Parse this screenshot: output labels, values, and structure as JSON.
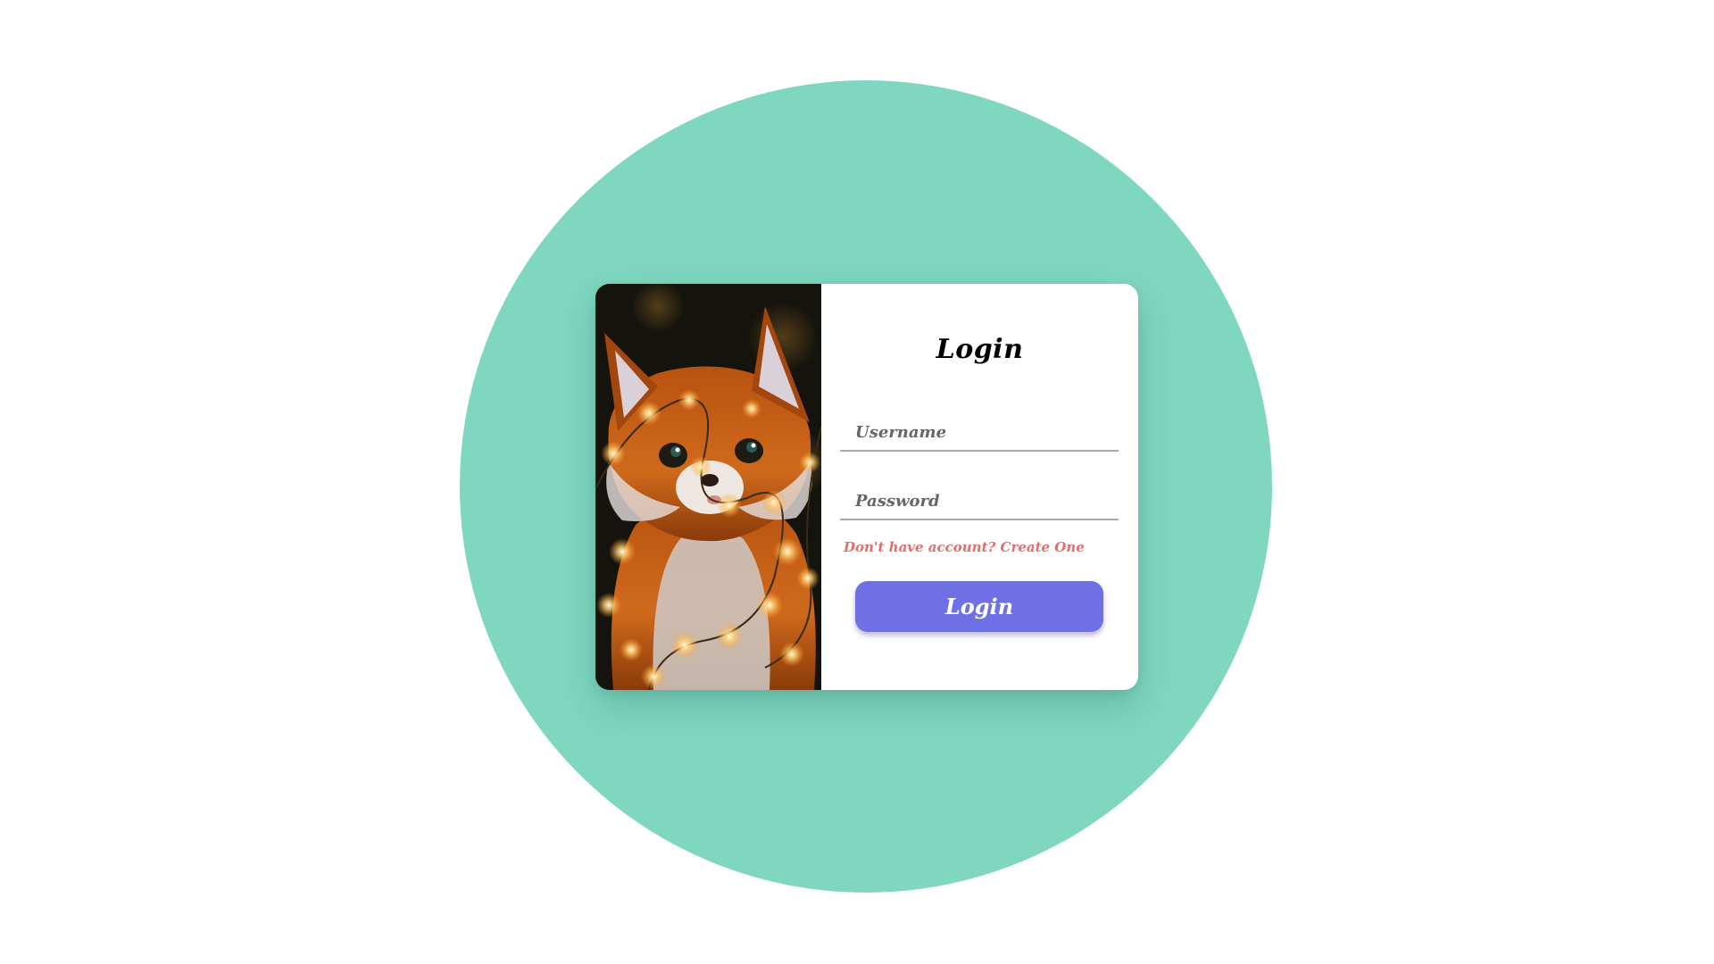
{
  "login_card": {
    "title": "Login",
    "username_placeholder": "Username",
    "password_placeholder": "Password",
    "signup_prompt": "Don't have account? Create One",
    "submit_label": "Login"
  },
  "illustration": {
    "subject": "fox-wrapped-in-fairy-lights"
  },
  "colors": {
    "background_circle": "#7fd7c0",
    "button": "#7070e6",
    "signup_link": "#e06e6e",
    "input_underline": "#a9a9a9"
  }
}
